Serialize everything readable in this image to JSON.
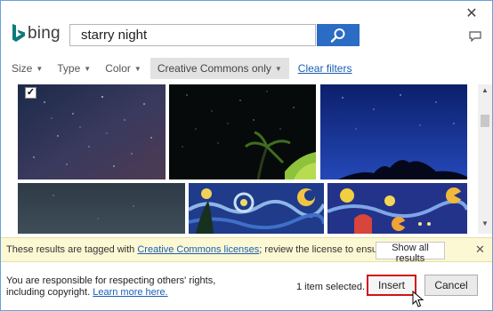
{
  "dialog": {
    "close_glyph": "✕",
    "feedback_icon": "speech-bubble-icon"
  },
  "brand": {
    "name": "bing",
    "logo_color": "#0e7a7a"
  },
  "search": {
    "value": "starry night",
    "button_icon": "search-icon",
    "button_color": "#2b6cc4"
  },
  "filters": {
    "items": [
      {
        "label": "Size"
      },
      {
        "label": "Type"
      },
      {
        "label": "Color"
      },
      {
        "label": "Creative Commons only"
      }
    ],
    "clear_label": "Clear filters"
  },
  "results": {
    "tiles": [
      {
        "description": "starry night sky",
        "selected": true
      },
      {
        "description": "palm tree under stars",
        "selected": false
      },
      {
        "description": "night sky over hill",
        "selected": false
      },
      {
        "description": "dark sky",
        "selected": false
      },
      {
        "description": "van gogh starry night painting",
        "selected": false
      },
      {
        "description": "starry night pacman artwork",
        "selected": false
      }
    ],
    "check_glyph": "✓"
  },
  "info_bar": {
    "text_before": "These results are tagged with ",
    "link": "Creative Commons licenses",
    "text_after": "; review the license to ensure you comply.",
    "show_all": "Show all results",
    "close_glyph": "✕"
  },
  "footer": {
    "notice": "You are responsible for respecting others' rights, including copyright. ",
    "learn_more": "Learn more here.",
    "selected_status": "1 item selected.",
    "insert": "Insert",
    "cancel": "Cancel"
  },
  "colors": {
    "accent": "#2b6cc4",
    "highlight_border": "#d0121b",
    "info_bg": "#fcf8d3",
    "link": "#1a5fb4"
  }
}
